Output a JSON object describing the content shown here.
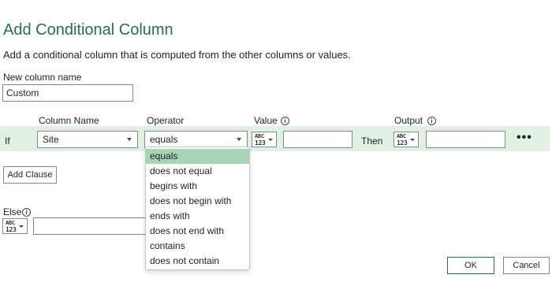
{
  "dialog": {
    "title": "Add Conditional Column",
    "subtitle": "Add a conditional column that is computed from the other columns or values."
  },
  "new_column": {
    "label": "New column name",
    "value": "Custom"
  },
  "headers": {
    "column_name": "Column Name",
    "operator": "Operator",
    "value": "Value",
    "output": "Output"
  },
  "clause": {
    "if_label": "If",
    "column": "Site",
    "operator": "equals",
    "value_type_top": "ABC",
    "value_type_bottom": "123",
    "value": "",
    "then_label": "Then",
    "output_type_top": "ABC",
    "output_type_bottom": "123",
    "output": "",
    "more_label": "•••"
  },
  "operator_options": [
    "equals",
    "does not equal",
    "begins with",
    "does not begin with",
    "ends with",
    "does not end with",
    "contains",
    "does not contain"
  ],
  "selected_operator_index": 0,
  "add_clause_label": "Add Clause",
  "else": {
    "label": "Else",
    "type_top": "ABC",
    "type_bottom": "123",
    "value": ""
  },
  "footer": {
    "ok_label": "OK",
    "cancel_label": "Cancel"
  },
  "colors": {
    "accent": "#217346",
    "row_highlight": "#dff1e3",
    "selected_option": "#a5d5b4",
    "ok_border": "#217346"
  },
  "icons": {
    "info": "info-icon",
    "dropdown": "chevron-down-icon",
    "type": "any-type-icon",
    "more": "more-options-icon"
  }
}
